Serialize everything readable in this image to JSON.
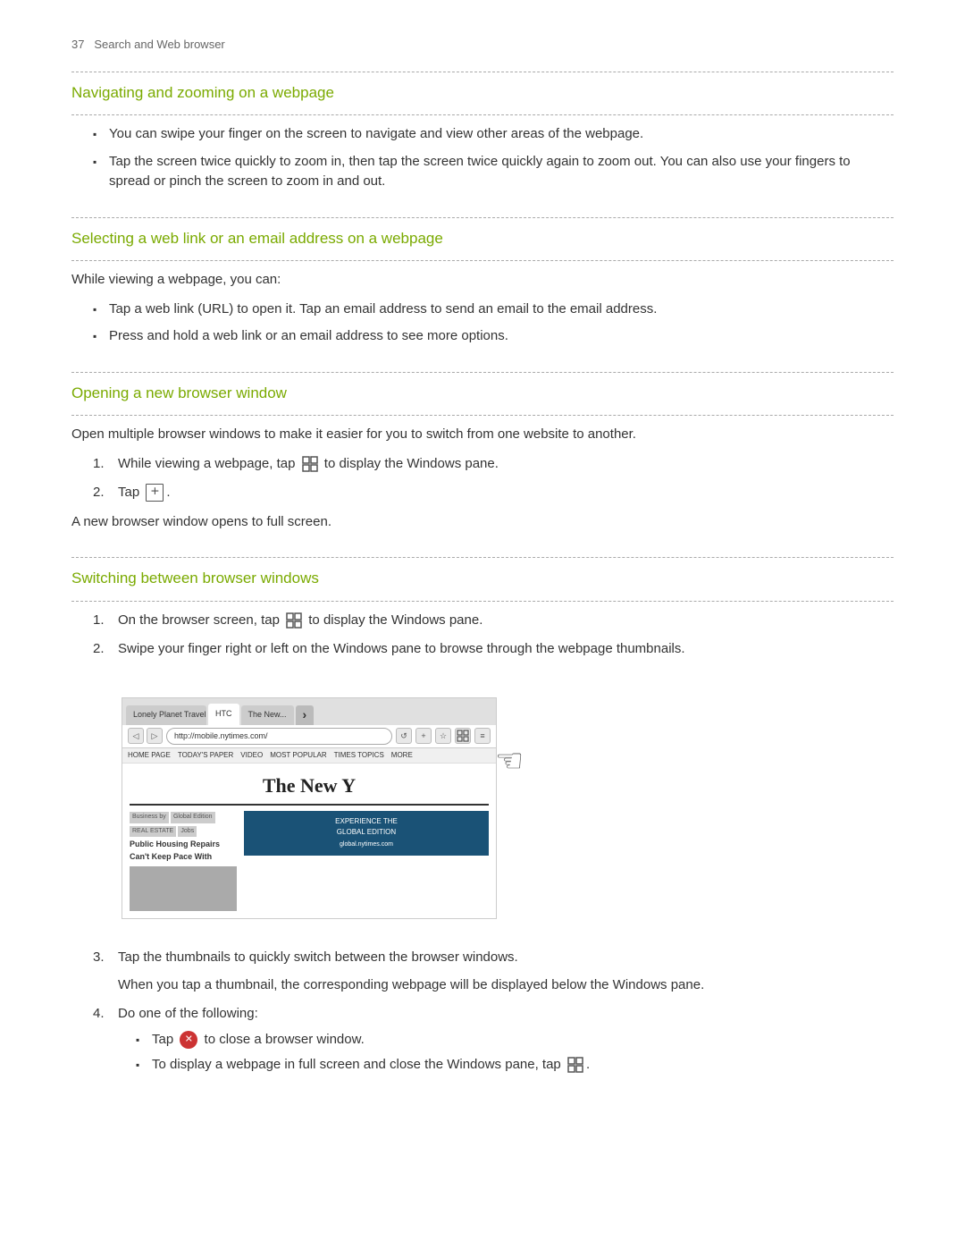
{
  "page": {
    "header": {
      "page_number": "37",
      "section": "Search and Web browser"
    },
    "sections": [
      {
        "id": "navigating",
        "title": "Navigating and zooming on a webpage",
        "bullets": [
          "You can swipe your finger on the screen to navigate and view other areas of the webpage.",
          "Tap the screen twice quickly to zoom in, then tap the screen twice quickly again to zoom out. You can also use your fingers to spread or pinch the screen to zoom in and out."
        ]
      },
      {
        "id": "selecting",
        "title": "Selecting a web link or an email address on a webpage",
        "intro": "While viewing a webpage, you can:",
        "bullets": [
          "Tap a web link (URL) to open it. Tap an email address to send an email to the email address.",
          "Press and hold a web link or an email address to see more options."
        ]
      },
      {
        "id": "opening",
        "title": "Opening a new browser window",
        "intro": "Open multiple browser windows to make it easier for you to switch from one website to another.",
        "steps": [
          "While viewing a webpage, tap [windows-icon] to display the Windows pane.",
          "Tap [plus-icon]."
        ],
        "outro": "A new browser window opens to full screen."
      },
      {
        "id": "switching",
        "title": "Switching between browser windows",
        "steps": [
          "On the browser screen, tap [windows-icon] to display the Windows pane.",
          "Swipe your finger right or left on the Windows pane to browse through the webpage thumbnails."
        ],
        "step3": "Tap the thumbnails to quickly switch between the browser windows.",
        "step3_detail": "When you tap a thumbnail, the corresponding webpage will be displayed below the Windows pane.",
        "step4_intro": "Do one of the following:",
        "step4_bullets": [
          "Tap [x-icon] to close a browser window.",
          "To display a webpage in full screen and close the Windows pane, tap [windows-icon]."
        ]
      }
    ],
    "browser_screenshot": {
      "tabs": [
        "Lonely Planet Travel Go...",
        "HTC",
        "The New..."
      ],
      "address": "http://mobile.nytimes.com/",
      "menu_items": [
        "HOME PAGE",
        "TODAY'S PAPER",
        "VIDEO",
        "MOST POPULAR",
        "TIMES TOPICS",
        "MORE"
      ],
      "site_name": "The New Y",
      "article_categories": [
        "Business by",
        "Global Edition",
        "REAL ESTATE",
        "Jobs"
      ],
      "article_title": "Public Housing Repairs Can't Keep Pace With",
      "ad_text": "EXPERIENCE THE GLOBAL EDITION\nglobal.nytimes.com"
    }
  }
}
